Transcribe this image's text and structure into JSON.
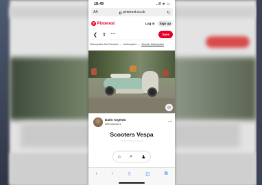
{
  "status_bar": {
    "time": "18:49",
    "icons": "..ll ᯤ ▭"
  },
  "browser": {
    "text_size_label": "AA",
    "url": "pinterest.co.uk"
  },
  "header": {
    "logo_text": "Pinterest",
    "logo_badge": "P",
    "login_label": "Log in",
    "signup_label": "Sign up"
  },
  "actions": {
    "back_glyph": "❮",
    "share_glyph": "⇧",
    "more_glyph": "···",
    "save_label": "Save"
  },
  "breadcrumb": {
    "items": [
      "Motorcycles And Scooters",
      "Motorcycles",
      "Scooter Motorcycles"
    ],
    "sep": "›"
  },
  "pin": {
    "lens_glyph": "⊙",
    "author_name": "Dario Argento",
    "followers": "585 followers",
    "more_glyph": "···",
    "title": "Scooters Vespa"
  },
  "pin_nav": {
    "home_glyph": "⌂",
    "search_glyph": "⌕",
    "profile_glyph": "♟"
  },
  "toolbar": {
    "back_glyph": "‹",
    "forward_glyph": "›",
    "share_glyph": "⇧",
    "bookmarks_glyph": "◫",
    "tabs_glyph": "⧉"
  },
  "colors": {
    "brand": "#e60023",
    "ios_blue": "#2f7cf6"
  }
}
